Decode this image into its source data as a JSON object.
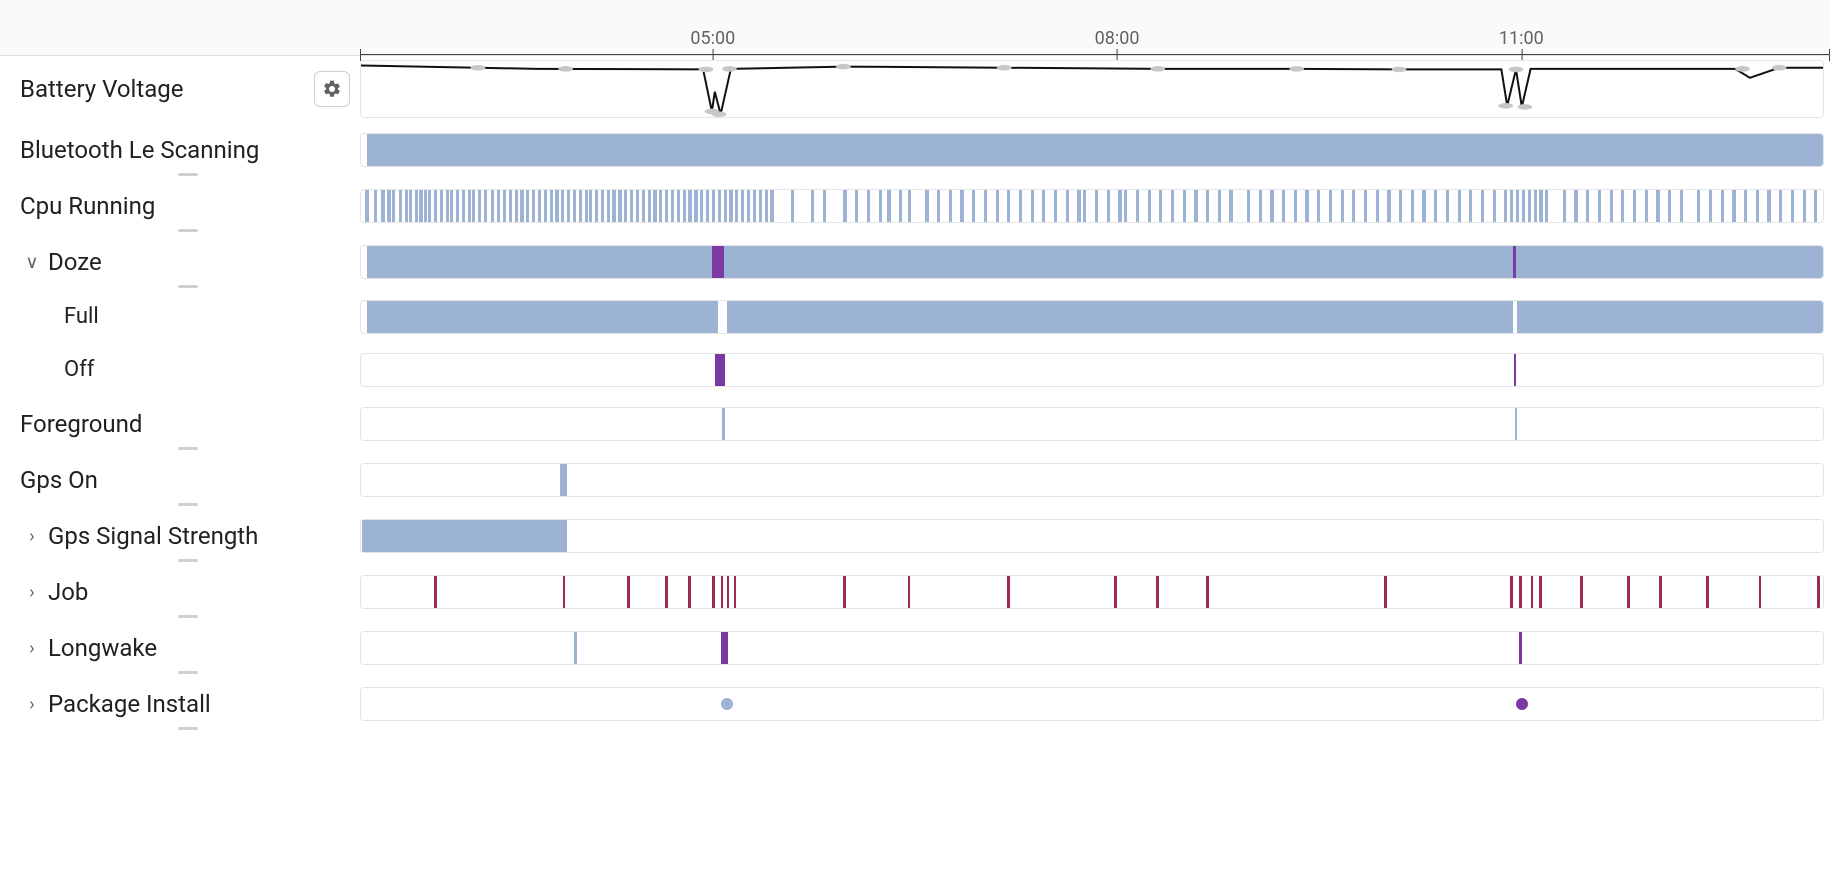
{
  "timeline": {
    "ticks": [
      {
        "label": "05:00",
        "percent": 24.0
      },
      {
        "label": "08:00",
        "percent": 51.5
      },
      {
        "label": "11:00",
        "percent": 79.0
      }
    ]
  },
  "rows": {
    "battery_voltage": {
      "label": "Battery Voltage"
    },
    "ble_scanning": {
      "label": "Bluetooth Le Scanning"
    },
    "cpu_running": {
      "label": "Cpu Running"
    },
    "doze": {
      "label": "Doze"
    },
    "doze_full": {
      "label": "Full"
    },
    "doze_off": {
      "label": "Off"
    },
    "foreground": {
      "label": "Foreground"
    },
    "gps_on": {
      "label": "Gps On"
    },
    "gps_signal": {
      "label": "Gps Signal Strength"
    },
    "job": {
      "label": "Job"
    },
    "longwake": {
      "label": "Longwake"
    },
    "package_install": {
      "label": "Package Install"
    }
  },
  "colors": {
    "blue": "#9db3d4",
    "purple": "#7a3aa1",
    "maroon": "#a12a52",
    "grey_dot": "#c0c0c0"
  },
  "chart_data": {
    "type": "timeline",
    "time_axis": {
      "start": "02:23",
      "end": "13:00",
      "ticks": [
        "05:00",
        "08:00",
        "11:00"
      ]
    },
    "tracks": [
      {
        "name": "Battery Voltage",
        "kind": "line",
        "points_percent_x": [
          0,
          8,
          12,
          23.4,
          24.0,
          24.2,
          24.6,
          25.3,
          33.0,
          44.0,
          54.5,
          64.0,
          71.0,
          78.0,
          78.4,
          79.0,
          79.4,
          80.0,
          94.0,
          95.0,
          97.0,
          100
        ],
        "y_rel": [
          0.08,
          0.12,
          0.14,
          0.15,
          0.9,
          0.55,
          0.95,
          0.14,
          0.1,
          0.12,
          0.14,
          0.14,
          0.15,
          0.15,
          0.8,
          0.15,
          0.82,
          0.14,
          0.14,
          0.3,
          0.12,
          0.12
        ],
        "marker_dots_percent": [
          8,
          14,
          23.6,
          24.0,
          24.5,
          25.2,
          33,
          44,
          54.5,
          64,
          71,
          78.3,
          79.0,
          79.6,
          94.5,
          97
        ]
      },
      {
        "name": "Bluetooth Le Scanning",
        "kind": "span",
        "segments": [
          {
            "start": 0.4,
            "end": 100,
            "color": "blue"
          }
        ]
      },
      {
        "name": "Cpu Running",
        "kind": "ticks",
        "color": "blue",
        "ticks_percent": [
          0.3,
          0.9,
          1.4,
          1.8,
          2.1,
          2.6,
          3.0,
          3.3,
          3.7,
          4.0,
          4.3,
          4.6,
          5.0,
          5.4,
          5.8,
          6.1,
          6.5,
          6.9,
          7.3,
          7.6,
          8.0,
          8.4,
          8.9,
          9.3,
          9.7,
          10.1,
          10.5,
          10.9,
          11.3,
          11.7,
          12.1,
          12.5,
          12.9,
          13.3,
          13.7,
          14.1,
          14.5,
          14.9,
          15.3,
          15.6,
          16.0,
          16.4,
          16.8,
          17.2,
          17.6,
          18.0,
          18.4,
          18.8,
          19.2,
          19.6,
          20.0,
          20.4,
          20.8,
          21.2,
          21.6,
          22.0,
          22.4,
          22.8,
          23.2,
          23.6,
          24.0,
          24.4,
          24.8,
          25.2,
          25.6,
          26.0,
          26.4,
          26.8,
          27.2,
          27.6,
          28.0,
          29.4,
          30.8,
          31.6,
          33.0,
          33.8,
          34.6,
          35.4,
          36.0,
          36.8,
          37.4,
          38.6,
          39.4,
          40.2,
          41.0,
          41.8,
          42.6,
          43.4,
          44.2,
          45.0,
          45.8,
          46.6,
          47.4,
          48.2,
          49.0,
          49.4,
          50.2,
          51.0,
          51.8,
          52.2,
          53.0,
          53.8,
          54.6,
          55.4,
          56.2,
          57.0,
          57.8,
          58.6,
          59.4,
          60.6,
          61.4,
          62.2,
          63.0,
          63.8,
          64.6,
          65.4,
          66.2,
          67.0,
          67.8,
          68.6,
          69.4,
          70.2,
          71.0,
          71.8,
          72.6,
          73.4,
          74.2,
          75.0,
          75.8,
          76.6,
          77.4,
          78.2,
          78.6,
          79.0,
          79.4,
          79.8,
          80.2,
          80.6,
          81.0,
          82.2,
          83.0,
          83.8,
          84.6,
          85.4,
          86.2,
          87.0,
          87.8,
          88.6,
          89.4,
          90.2,
          91.4,
          92.2,
          93.0,
          93.8,
          94.6,
          95.4,
          96.2,
          97.0,
          97.8,
          98.6,
          99.4
        ]
      },
      {
        "name": "Doze",
        "kind": "span",
        "segments": [
          {
            "start": 0.4,
            "end": 24.0,
            "color": "blue"
          },
          {
            "start": 24.0,
            "end": 24.8,
            "color": "purple"
          },
          {
            "start": 24.8,
            "end": 78.8,
            "color": "blue"
          },
          {
            "start": 78.8,
            "end": 79.0,
            "color": "purple"
          },
          {
            "start": 79.0,
            "end": 100,
            "color": "blue"
          }
        ]
      },
      {
        "name": "Doze > Full",
        "kind": "span",
        "segments": [
          {
            "start": 0.4,
            "end": 24.4,
            "color": "blue"
          },
          {
            "start": 25.0,
            "end": 78.8,
            "color": "blue"
          },
          {
            "start": 79.1,
            "end": 100,
            "color": "blue"
          }
        ]
      },
      {
        "name": "Doze > Off",
        "kind": "span",
        "segments": [
          {
            "start": 24.2,
            "end": 24.9,
            "color": "purple"
          },
          {
            "start": 78.85,
            "end": 79.0,
            "color": "purple"
          }
        ]
      },
      {
        "name": "Foreground",
        "kind": "ticks",
        "color": "blue",
        "ticks_percent": [
          24.7,
          78.9
        ]
      },
      {
        "name": "Gps On",
        "kind": "span",
        "segments": [
          {
            "start": 13.6,
            "end": 14.1,
            "color": "blue"
          }
        ]
      },
      {
        "name": "Gps Signal Strength",
        "kind": "span",
        "segments": [
          {
            "start": 0.1,
            "end": 14.1,
            "color": "blue"
          }
        ]
      },
      {
        "name": "Job",
        "kind": "ticks",
        "color": "maroon",
        "ticks_percent": [
          5.0,
          13.8,
          18.2,
          20.8,
          22.4,
          24.0,
          24.6,
          25.0,
          25.5,
          33.0,
          37.4,
          44.2,
          51.5,
          54.4,
          57.8,
          70.0,
          78.6,
          79.2,
          80.0,
          80.6,
          83.4,
          86.6,
          88.8,
          92.0,
          95.6,
          99.6
        ]
      },
      {
        "name": "Longwake",
        "kind": "mixed",
        "events": [
          {
            "percent": 14.6,
            "color": "blue",
            "w": 0.15
          },
          {
            "percent": 24.6,
            "color": "purple",
            "w": 0.5
          },
          {
            "percent": 79.2,
            "color": "purple",
            "w": 0.2
          }
        ]
      },
      {
        "name": "Package Install",
        "kind": "dots",
        "dots": [
          {
            "percent": 25.0,
            "color": "blue"
          },
          {
            "percent": 79.4,
            "color": "purple"
          }
        ]
      }
    ]
  }
}
